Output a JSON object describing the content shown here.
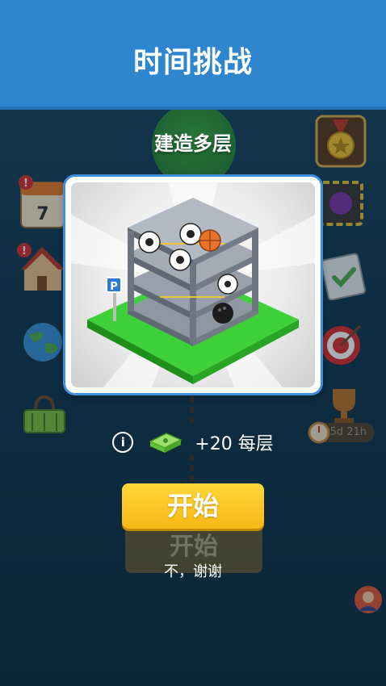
{
  "header": {
    "title": "时间挑战"
  },
  "floor_label": "建造多层",
  "reward": {
    "amount_text": "+20 每层",
    "info_icon": "info-icon",
    "cash_icon": "cash-stack-icon"
  },
  "buttons": {
    "start_label": "开始",
    "start_ghost_label": "开始",
    "no_thanks_label": "不，谢谢"
  },
  "side_badges": {
    "timer_text": "5d 21h",
    "calendar_day": "7"
  },
  "colors": {
    "header": "#2e86cf",
    "start_button": "#f6b814",
    "card_border": "#3f8fe0"
  }
}
